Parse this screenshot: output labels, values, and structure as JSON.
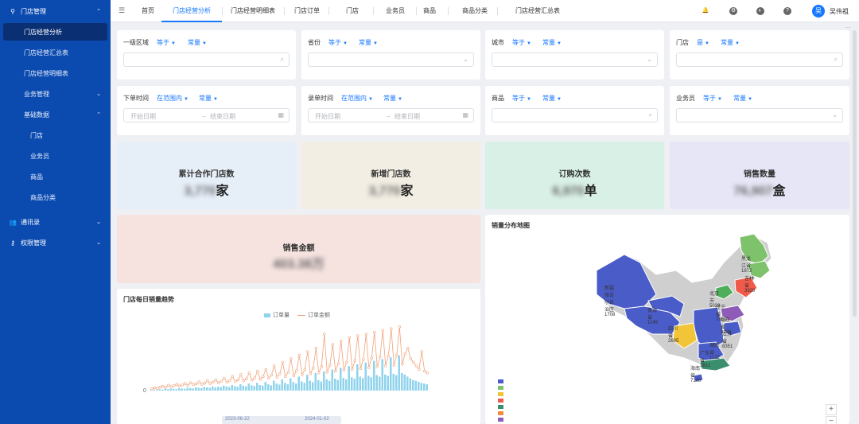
{
  "sidebar": {
    "store_mgmt": "门店管理",
    "store_analysis": "门店经营分析",
    "store_summary": "门店经营汇总表",
    "store_detail": "门店经营明细表",
    "business_mgmt": "业务管理",
    "basic_data": "基础数据",
    "store": "门店",
    "salesman": "业务员",
    "product": "商品",
    "product_category": "商品分类",
    "contacts": "通讯录",
    "permissions": "权限管理"
  },
  "tabs": [
    "首页",
    "门店经营分析",
    "门店经营明细表",
    "门店订单",
    "门店",
    "业务员",
    "商品",
    "商品分类",
    "门店经营汇总表"
  ],
  "user": {
    "avatar": "吴",
    "name": "吴伟祖"
  },
  "filters": {
    "region": {
      "label": "一级区域",
      "op": "等于",
      "type": "常量"
    },
    "province": {
      "label": "省份",
      "op": "等于",
      "type": "常量"
    },
    "city": {
      "label": "城市",
      "op": "等于",
      "type": "常量"
    },
    "store": {
      "label": "门店",
      "op": "是",
      "type": "常量"
    },
    "order_time": {
      "label": "下单时间",
      "op": "在范围内",
      "type": "常量",
      "start": "开始日期",
      "end": "结束日期"
    },
    "entry_time": {
      "label": "录单时间",
      "op": "在范围内",
      "type": "常量",
      "start": "开始日期",
      "end": "结束日期"
    },
    "product": {
      "label": "商品",
      "op": "等于",
      "type": "常量"
    },
    "salesman": {
      "label": "业务员",
      "op": "等于",
      "type": "常量"
    }
  },
  "stats": {
    "cum_stores": {
      "title": "累计合作门店数",
      "value": "3,770",
      "unit": "家"
    },
    "new_stores": {
      "title": "新增门店数",
      "value": "3,770",
      "unit": "家"
    },
    "orders": {
      "title": "订购次数",
      "value": "6,970",
      "unit": "单"
    },
    "quantity": {
      "title": "销售数量",
      "value": "76,907",
      "unit": "盒"
    },
    "amount": {
      "title": "销售金额",
      "value": "403.38万"
    }
  },
  "trend_panel": {
    "title": "门店每日销量趋势",
    "legend_count": "订单量",
    "legend_amount": "订单金额",
    "y_zero": "0",
    "date_start": "2023-06-22",
    "date_end": "2024-01-02"
  },
  "map_panel": {
    "title": "销量分布地图",
    "labels": [
      "黑龙江省 1872",
      "吉林省 3920",
      "新疆维吾尔自治区 1708",
      "北京市 5028",
      "辽宁省 7860",
      "青海省 1149",
      "山东省 9226",
      "四川省 2605",
      "江苏省 8351",
      "湖南省 1122",
      "广东省 3811",
      "海南省 7100"
    ],
    "zoom_in": "+",
    "zoom_out": "−"
  },
  "colors": {
    "sidebar": "#0b4bb0",
    "accent": "#1677ff",
    "bar": "#8fd3ec",
    "line": "#f0a27a"
  },
  "chart_data": {
    "type": "bar",
    "title": "门店每日销量趋势",
    "series": [
      {
        "name": "订单量",
        "values": [
          2,
          3,
          2,
          4,
          3,
          5,
          4,
          6,
          5,
          4,
          7,
          6,
          5,
          8,
          7,
          6,
          9,
          8,
          7,
          10,
          9,
          8,
          12,
          9,
          11,
          10,
          14,
          12,
          10,
          16,
          13,
          11,
          18,
          14,
          12,
          20,
          15,
          13,
          22,
          16,
          14,
          25,
          18,
          15,
          28,
          20,
          17,
          32,
          22,
          18,
          35,
          24,
          20,
          40,
          26,
          22,
          45,
          28,
          24,
          50,
          30,
          26,
          55,
          32,
          28,
          60,
          34,
          30,
          65,
          36,
          32,
          70,
          38,
          34,
          75,
          40,
          36,
          80,
          42,
          38,
          85,
          44,
          40,
          90,
          46,
          42,
          95,
          48,
          44,
          100,
          50,
          46,
          40,
          35,
          30,
          28,
          25,
          22,
          20,
          18
        ]
      },
      {
        "name": "订单金额",
        "values": [
          5,
          8,
          6,
          10,
          12,
          9,
          15,
          11,
          14,
          18,
          13,
          16,
          20,
          15,
          22,
          17,
          19,
          25,
          18,
          21,
          28,
          20,
          24,
          30,
          22,
          26,
          35,
          24,
          28,
          40,
          26,
          30,
          45,
          28,
          33,
          50,
          30,
          36,
          55,
          32,
          40,
          60,
          35,
          44,
          70,
          38,
          48,
          80,
          40,
          52,
          90,
          42,
          56,
          100,
          45,
          60,
          110,
          48,
          64,
          120,
          50,
          68,
          160,
          52,
          72,
          130,
          55,
          76,
          140,
          58,
          80,
          150,
          60,
          85,
          155,
          62,
          88,
          160,
          65,
          92,
          165,
          68,
          95,
          170,
          70,
          98,
          175,
          72,
          100,
          180,
          75,
          104,
          120,
          90,
          80,
          70,
          60,
          110,
          55,
          50
        ]
      }
    ],
    "xlabel": "",
    "ylabel": ""
  }
}
